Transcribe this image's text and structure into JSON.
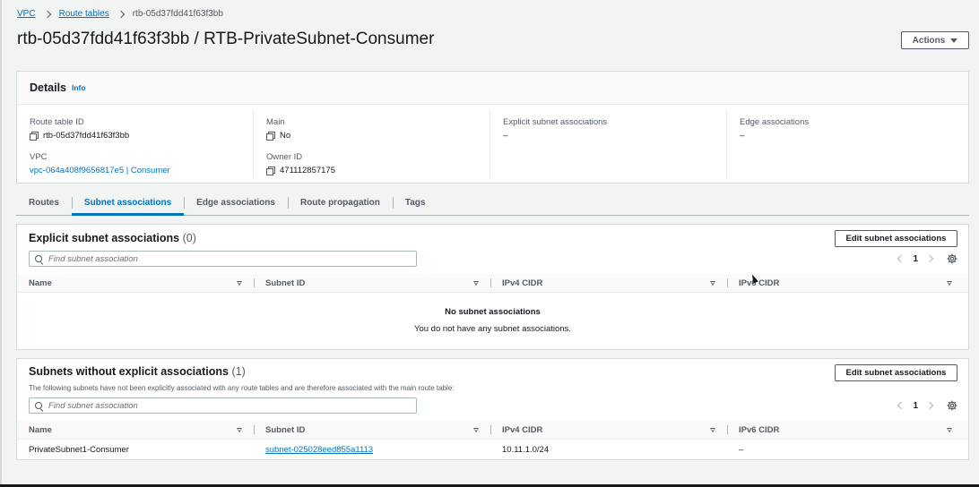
{
  "breadcrumb": {
    "root": "VPC",
    "parent": "Route tables",
    "current": "rtb-05d37fdd41f63f3bb"
  },
  "page": {
    "title": "rtb-05d37fdd41f63f3bb / RTB-PrivateSubnet-Consumer",
    "actions_label": "Actions"
  },
  "details": {
    "heading": "Details",
    "info": "Info",
    "route_table_id_label": "Route table ID",
    "route_table_id": "rtb-05d37fdd41f63f3bb",
    "vpc_label": "VPC",
    "vpc": "vpc-064a408f9656817e5 | Consumer",
    "main_label": "Main",
    "main": "No",
    "owner_id_label": "Owner ID",
    "owner_id": "471112857175",
    "explicit_label": "Explicit subnet associations",
    "explicit": "–",
    "edge_label": "Edge associations",
    "edge": "–"
  },
  "tabs": [
    "Routes",
    "Subnet associations",
    "Edge associations",
    "Route propagation",
    "Tags"
  ],
  "explicit": {
    "title": "Explicit subnet associations",
    "count": "(0)",
    "edit_label": "Edit subnet associations",
    "search_placeholder": "Find subnet association",
    "page": "1",
    "columns": [
      "Name",
      "Subnet ID",
      "IPv4 CIDR",
      "IPv6 CIDR"
    ],
    "empty_title": "No subnet associations",
    "empty_desc": "You do not have any subnet associations."
  },
  "subnets": {
    "title": "Subnets without explicit associations",
    "count": "(1)",
    "description": "The following subnets have not been explicitly associated with any route tables and are therefore associated with the main route table:",
    "edit_label": "Edit subnet associations",
    "search_placeholder": "Find subnet association",
    "page": "1",
    "columns": [
      "Name",
      "Subnet ID",
      "IPv4 CIDR",
      "IPv6 CIDR"
    ],
    "rows": [
      {
        "name": "PrivateSubnet1-Consumer",
        "subnet_id": "subnet-025028eed855a1113",
        "ipv4": "10.11.1.0/24",
        "ipv6": "–"
      }
    ]
  }
}
